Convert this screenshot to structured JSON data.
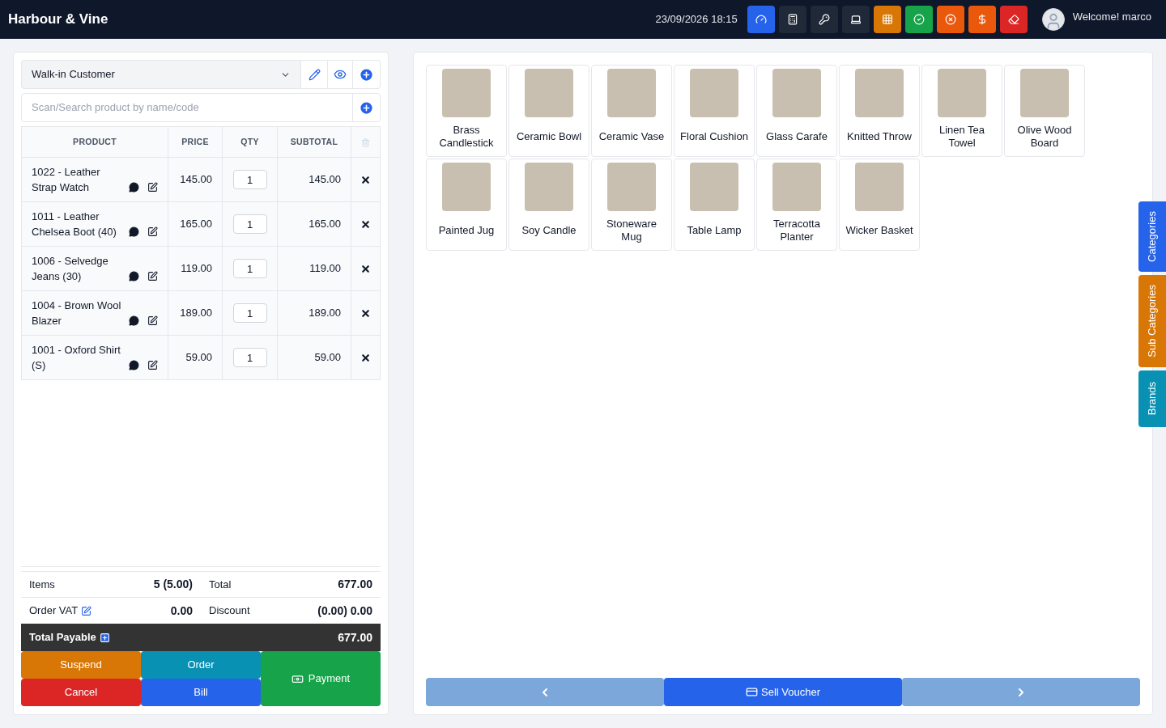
{
  "header": {
    "brand": "Harbour & Vine",
    "datetime": "23/09/2026 18:15",
    "welcome": "Welcome! marco",
    "tools": [
      {
        "kind": "dashboard",
        "color": "#2563eb"
      },
      {
        "kind": "calculator",
        "color": "#1f2937"
      },
      {
        "kind": "key",
        "color": "#1f2937"
      },
      {
        "kind": "screen",
        "color": "#1f2937"
      },
      {
        "kind": "grid",
        "color": "#d97706"
      },
      {
        "kind": "check",
        "color": "#16a34a"
      },
      {
        "kind": "close",
        "color": "#ea580c"
      },
      {
        "kind": "dollar",
        "color": "#ea580c"
      },
      {
        "kind": "eraser",
        "color": "#dc2626"
      }
    ]
  },
  "customer": {
    "value": "Walk-in Customer"
  },
  "search": {
    "placeholder": "Scan/Search product by name/code"
  },
  "cart": {
    "columns": [
      "PRODUCT",
      "PRICE",
      "QTY",
      "SUBTOTAL"
    ],
    "rows": [
      {
        "product": "1022 - Leather Strap Watch",
        "price": "145.00",
        "qty": "1",
        "subtotal": "145.00"
      },
      {
        "product": "1011 - Leather Chelsea Boot (40)",
        "price": "165.00",
        "qty": "1",
        "subtotal": "165.00"
      },
      {
        "product": "1006 - Selvedge Jeans (30)",
        "price": "119.00",
        "qty": "1",
        "subtotal": "119.00"
      },
      {
        "product": "1004 - Brown Wool Blazer",
        "price": "189.00",
        "qty": "1",
        "subtotal": "189.00"
      },
      {
        "product": "1001 - Oxford Shirt (S)",
        "price": "59.00",
        "qty": "1",
        "subtotal": "59.00"
      }
    ]
  },
  "totals": {
    "items_label": "Items",
    "items_value": "5 (5.00)",
    "total_label": "Total",
    "total_value": "677.00",
    "vat_label": "Order VAT",
    "vat_value": "0.00",
    "discount_label": "Discount",
    "discount_value": "(0.00) 0.00",
    "payable_label": "Total Payable",
    "payable_value": "677.00"
  },
  "actions": {
    "suspend": "Suspend",
    "order": "Order",
    "payment": "Payment",
    "cancel": "Cancel",
    "bill": "Bill"
  },
  "products": [
    "Brass Candlestick",
    "Ceramic Bowl",
    "Ceramic Vase",
    "Floral Cushion",
    "Glass Carafe",
    "Knitted Throw",
    "Linen Tea Towel",
    "Olive Wood Board",
    "Painted Jug",
    "Soy Candle",
    "Stoneware Mug",
    "Table Lamp",
    "Terracotta Planter",
    "Wicker Basket"
  ],
  "pager": {
    "sell_voucher": "Sell Voucher"
  },
  "side_tabs": [
    {
      "label": "Categories",
      "color": "#2563eb"
    },
    {
      "label": "Sub Categories",
      "color": "#d97706"
    },
    {
      "label": "Brands",
      "color": "#0891b2"
    }
  ]
}
